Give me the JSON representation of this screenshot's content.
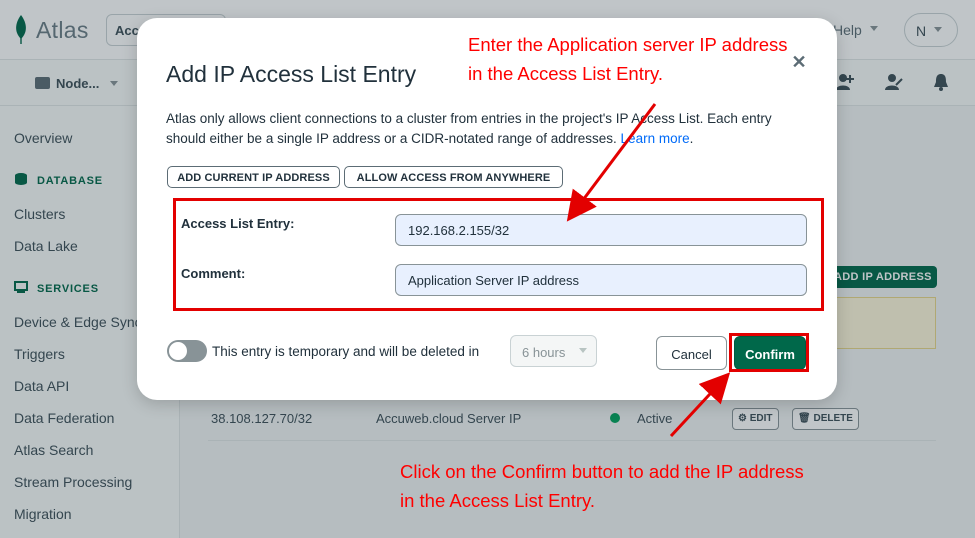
{
  "app": {
    "logo_text": "Atlas",
    "org_label": "Accu",
    "help_label": "Help",
    "avatar_initial": "N",
    "project_label": "Node..."
  },
  "sidebar": {
    "overview": "Overview",
    "database_heading": "DATABASE",
    "clusters": "Clusters",
    "data_lake": "Data Lake",
    "services_heading": "SERVICES",
    "device_sync": "Device & Edge Sync",
    "triggers": "Triggers",
    "data_api": "Data API",
    "data_federation": "Data Federation",
    "atlas_search": "Atlas Search",
    "stream_processing": "Stream Processing",
    "migration": "Migration"
  },
  "background_table": {
    "add_ip_label": "ADD IP ADDRESS",
    "row": {
      "ip": "38.108.127.70/32",
      "comment": "Accuweb.cloud Server IP",
      "status": "Active",
      "edit_label": "EDIT",
      "delete_label": "DELETE"
    }
  },
  "modal": {
    "title": "Add IP Access List Entry",
    "description": "Atlas only allows client connections to a cluster from entries in the project's IP Access List. Each entry should either be a single IP address or a CIDR-notated range of addresses.",
    "learn_more": "Learn more",
    "desc_end": ".",
    "add_current_ip": "ADD CURRENT IP ADDRESS",
    "allow_anywhere": "ALLOW ACCESS FROM ANYWHERE",
    "access_list_label": "Access List Entry:",
    "access_list_value": "192.168.2.155/32",
    "comment_label": "Comment:",
    "comment_value": "Application Server IP address",
    "temporary_label": "This entry is temporary and will be deleted in",
    "temporary_enabled": false,
    "hours_value": "6 hours",
    "cancel_label": "Cancel",
    "confirm_label": "Confirm"
  },
  "annotations": {
    "top_line1": "Enter the Application server IP address",
    "top_line2": "in the Access List Entry.",
    "bottom_line1": "Click on the Confirm button to add the IP address",
    "bottom_line2": "in the Access List Entry."
  },
  "colors": {
    "accent": "#00684a",
    "annotation": "#ff0000",
    "link": "#016bf8"
  }
}
